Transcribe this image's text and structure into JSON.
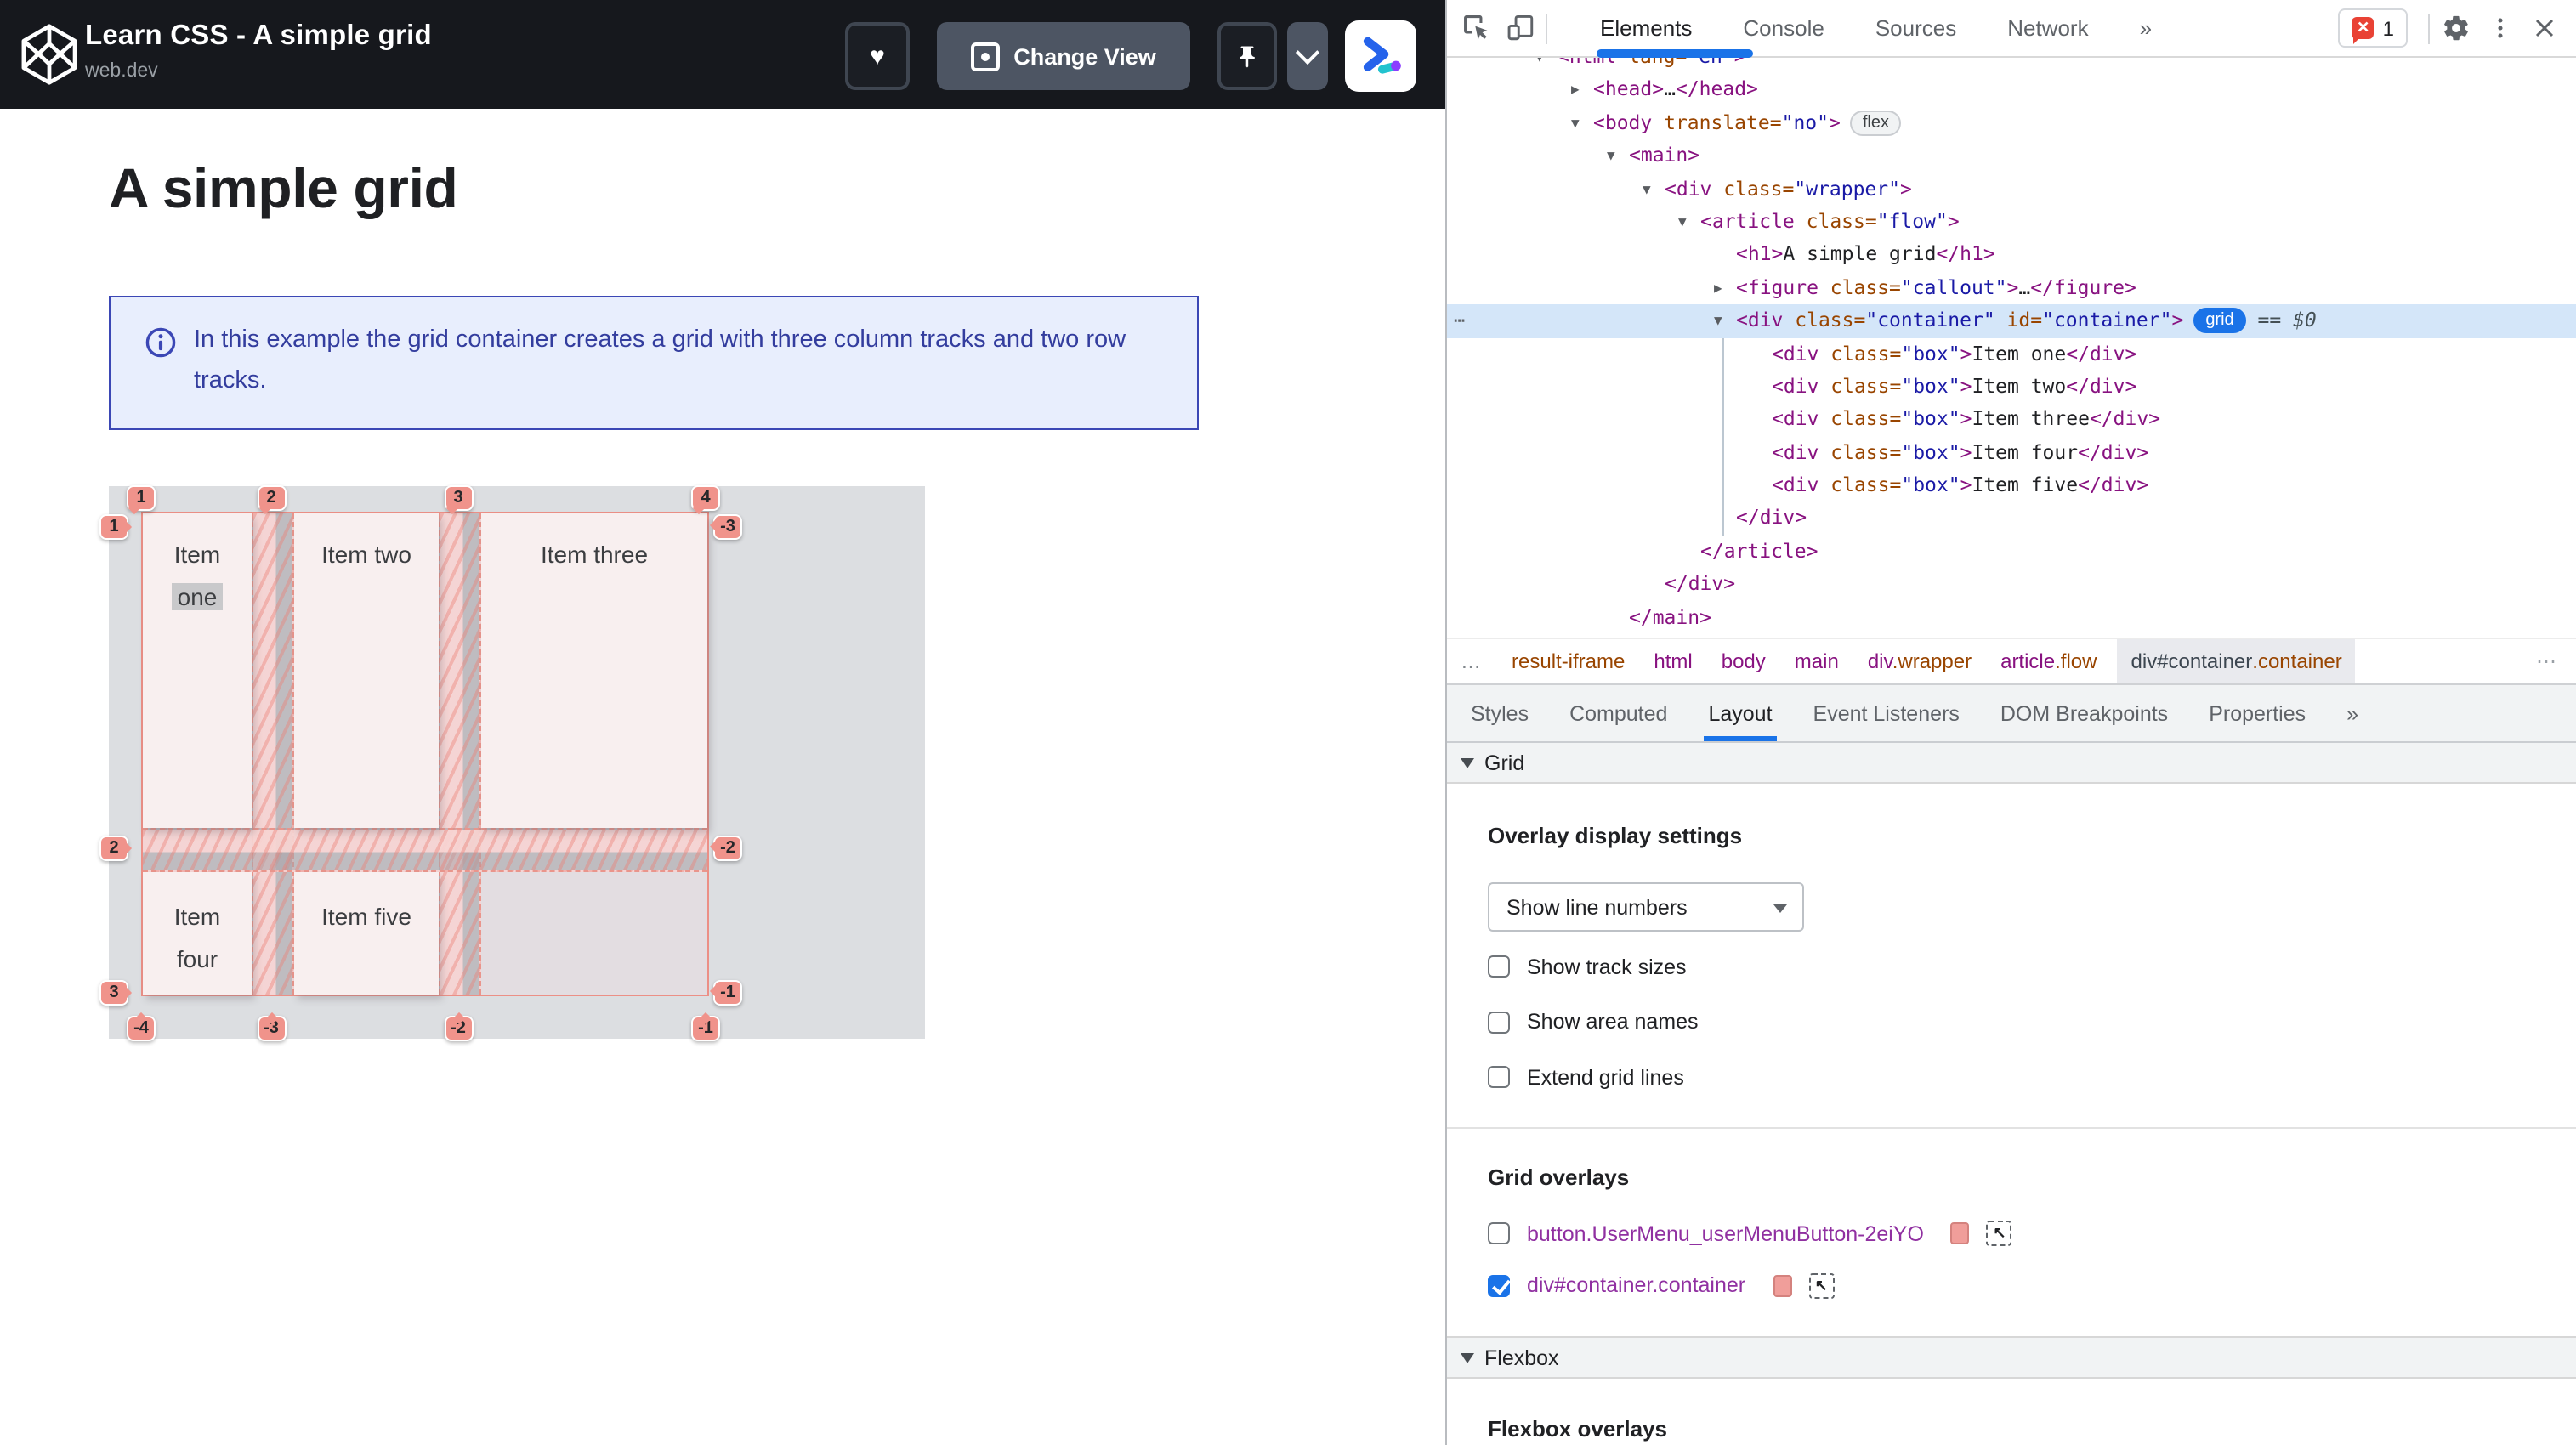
{
  "colors": {
    "accent_blue": "#1a73e8",
    "grid_salmon": "#f0938b",
    "callout_blue": "#3b47b5",
    "error_red": "#e94235",
    "header_dark": "#16181d"
  },
  "embed": {
    "title": "Learn CSS - A simple grid",
    "subtitle": "web.dev",
    "buttons": {
      "favorite_icon": "heart-icon",
      "change_view_label": "Change View",
      "pin_icon": "pin-icon",
      "more_icon": "chevron-down-icon",
      "logo_icon": "codepen-arrow-logo"
    }
  },
  "article": {
    "heading": "A simple grid",
    "callout": {
      "icon": "info-icon",
      "text": "In this example the grid container creates a grid with three column tracks and two row tracks."
    }
  },
  "grid_demo": {
    "items": [
      {
        "cell": "r1c1",
        "lines": [
          "Item",
          "one"
        ],
        "highlight_line": 1
      },
      {
        "cell": "r1c2",
        "lines": [
          "Item two"
        ]
      },
      {
        "cell": "r1c3",
        "lines": [
          "Item three"
        ]
      },
      {
        "cell": "r2c1",
        "lines": [
          "Item",
          "four"
        ]
      },
      {
        "cell": "r2c2",
        "lines": [
          "Item five"
        ]
      }
    ],
    "badges": {
      "top": [
        "1",
        "2",
        "3",
        "4"
      ],
      "bottom": [
        "-4",
        "-3",
        "-2",
        "-1"
      ],
      "left": [
        "1",
        "2",
        "3"
      ],
      "right": [
        "-3",
        "-2",
        "-1"
      ]
    }
  },
  "devtools": {
    "toolbar": {
      "icons": [
        "inspect-icon",
        "device-toolbar-icon"
      ],
      "tabs": [
        {
          "label": "Elements",
          "active": true
        },
        {
          "label": "Console",
          "active": false
        },
        {
          "label": "Sources",
          "active": false
        },
        {
          "label": "Network",
          "active": false
        },
        {
          "label": "»",
          "active": false
        }
      ],
      "error_count": "1",
      "right_icons": [
        "gear-icon",
        "kebab-menu-icon",
        "close-icon"
      ]
    },
    "dom_tree": {
      "rows": [
        {
          "ind": 0,
          "arrow": "v",
          "tokens": [
            [
              "tag",
              "<html"
            ],
            [
              "attr",
              " lang="
            ],
            [
              "val",
              "\"en\""
            ],
            [
              "tag",
              ">"
            ]
          ]
        },
        {
          "ind": 1,
          "arrow": "r",
          "tokens": [
            [
              "tag",
              "<head>"
            ],
            [
              "txt",
              "…"
            ],
            [
              "tag",
              "</head>"
            ]
          ]
        },
        {
          "ind": 1,
          "arrow": "v",
          "tokens": [
            [
              "tag",
              "<body"
            ],
            [
              "attr",
              " translate="
            ],
            [
              "val",
              "\"no\""
            ],
            [
              "tag",
              ">"
            ]
          ],
          "badge": "flex"
        },
        {
          "ind": 2,
          "arrow": "v",
          "tokens": [
            [
              "tag",
              "<main>"
            ]
          ]
        },
        {
          "ind": 3,
          "arrow": "v",
          "tokens": [
            [
              "tag",
              "<div"
            ],
            [
              "attr",
              " class="
            ],
            [
              "val",
              "\"wrapper\""
            ],
            [
              "tag",
              ">"
            ]
          ]
        },
        {
          "ind": 4,
          "arrow": "v",
          "tokens": [
            [
              "tag",
              "<article"
            ],
            [
              "attr",
              " class="
            ],
            [
              "val",
              "\"flow\""
            ],
            [
              "tag",
              ">"
            ]
          ]
        },
        {
          "ind": 5,
          "arrow": "",
          "tokens": [
            [
              "tag",
              "<h1>"
            ],
            [
              "txt",
              "A simple grid"
            ],
            [
              "tag",
              "</h1>"
            ]
          ]
        },
        {
          "ind": 5,
          "arrow": "r",
          "tokens": [
            [
              "tag",
              "<figure"
            ],
            [
              "attr",
              " class="
            ],
            [
              "val",
              "\"callout\""
            ],
            [
              "tag",
              ">"
            ],
            [
              "txt",
              "…"
            ],
            [
              "tag",
              "</figure>"
            ]
          ]
        },
        {
          "ind": 5,
          "arrow": "v",
          "selected": true,
          "gutter": "⋯",
          "tokens": [
            [
              "tag",
              "<div"
            ],
            [
              "attr",
              " class="
            ],
            [
              "val",
              "\"container\""
            ],
            [
              "attr",
              " id="
            ],
            [
              "val",
              "\"container\""
            ],
            [
              "tag",
              ">"
            ]
          ],
          "badge": "grid",
          "suffix": " == $0"
        },
        {
          "ind": 6,
          "arrow": "",
          "tokens": [
            [
              "tag",
              "<div"
            ],
            [
              "attr",
              " class="
            ],
            [
              "val",
              "\"box\""
            ],
            [
              "tag",
              ">"
            ],
            [
              "txt",
              "Item one"
            ],
            [
              "tag",
              "</div>"
            ]
          ]
        },
        {
          "ind": 6,
          "arrow": "",
          "tokens": [
            [
              "tag",
              "<div"
            ],
            [
              "attr",
              " class="
            ],
            [
              "val",
              "\"box\""
            ],
            [
              "tag",
              ">"
            ],
            [
              "txt",
              "Item two"
            ],
            [
              "tag",
              "</div>"
            ]
          ]
        },
        {
          "ind": 6,
          "arrow": "",
          "tokens": [
            [
              "tag",
              "<div"
            ],
            [
              "attr",
              " class="
            ],
            [
              "val",
              "\"box\""
            ],
            [
              "tag",
              ">"
            ],
            [
              "txt",
              "Item three"
            ],
            [
              "tag",
              "</div>"
            ]
          ]
        },
        {
          "ind": 6,
          "arrow": "",
          "tokens": [
            [
              "tag",
              "<div"
            ],
            [
              "attr",
              " class="
            ],
            [
              "val",
              "\"box\""
            ],
            [
              "tag",
              ">"
            ],
            [
              "txt",
              "Item four"
            ],
            [
              "tag",
              "</div>"
            ]
          ]
        },
        {
          "ind": 6,
          "arrow": "",
          "tokens": [
            [
              "tag",
              "<div"
            ],
            [
              "attr",
              " class="
            ],
            [
              "val",
              "\"box\""
            ],
            [
              "tag",
              ">"
            ],
            [
              "txt",
              "Item five"
            ],
            [
              "tag",
              "</div>"
            ]
          ]
        },
        {
          "ind": 5,
          "arrow": "",
          "tokens": [
            [
              "tag",
              "</div>"
            ]
          ]
        },
        {
          "ind": 4,
          "arrow": "",
          "tokens": [
            [
              "tag",
              "</article>"
            ]
          ]
        },
        {
          "ind": 3,
          "arrow": "",
          "tokens": [
            [
              "tag",
              "</div>"
            ]
          ]
        },
        {
          "ind": 2,
          "arrow": "",
          "tokens": [
            [
              "tag",
              "</main>"
            ]
          ]
        }
      ],
      "badge_labels": {
        "flex": "flex",
        "grid": "grid"
      }
    },
    "breadcrumbs": {
      "more_left": "…",
      "items": [
        {
          "segments": [
            [
              "cls",
              "result-iframe"
            ]
          ]
        },
        {
          "segments": [
            [
              "tag",
              "html"
            ]
          ]
        },
        {
          "segments": [
            [
              "tag",
              "body"
            ]
          ]
        },
        {
          "segments": [
            [
              "tag",
              "main"
            ]
          ]
        },
        {
          "segments": [
            [
              "tag",
              "div"
            ],
            [
              "cls",
              ".wrapper"
            ]
          ]
        },
        {
          "segments": [
            [
              "tag",
              "article"
            ],
            [
              "cls",
              ".flow"
            ]
          ]
        },
        {
          "segments": [
            [
              "tag",
              "div#container"
            ],
            [
              "cls",
              ".container"
            ]
          ],
          "selected": true
        }
      ],
      "more_right": "⋯"
    },
    "panel_tabs": [
      {
        "label": "Styles",
        "active": false
      },
      {
        "label": "Computed",
        "active": false
      },
      {
        "label": "Layout",
        "active": true
      },
      {
        "label": "Event Listeners",
        "active": false
      },
      {
        "label": "DOM Breakpoints",
        "active": false
      },
      {
        "label": "Properties",
        "active": false
      },
      {
        "label": "»",
        "active": false
      }
    ],
    "layout_panel": {
      "grid_section_label": "Grid",
      "overlay_settings_heading": "Overlay display settings",
      "select_value": "Show line numbers",
      "checkboxes": [
        {
          "label": "Show track sizes",
          "checked": false
        },
        {
          "label": "Show area names",
          "checked": false
        },
        {
          "label": "Extend grid lines",
          "checked": false
        }
      ],
      "grid_overlays_heading": "Grid overlays",
      "overlay_rows": [
        {
          "label": "button.UserMenu_userMenuButton-2eiYO",
          "checked": false,
          "swatch": "#f09e9a",
          "icon": "pick-element-icon"
        },
        {
          "label": "div#container.container",
          "checked": true,
          "swatch": "#f09e9a",
          "icon": "pick-element-icon"
        }
      ],
      "flexbox_section_label": "Flexbox",
      "flexbox_overlays_heading": "Flexbox overlays"
    }
  }
}
